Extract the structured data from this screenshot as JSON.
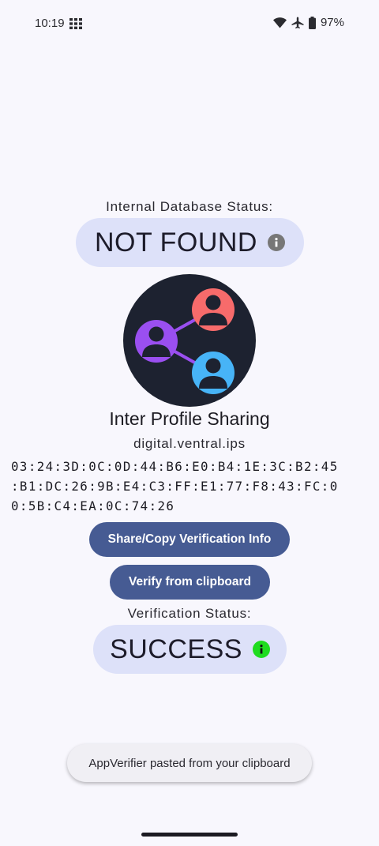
{
  "status_bar": {
    "time": "10:19",
    "battery": "97%",
    "icons": [
      "grid-icon",
      "wifi-icon",
      "airplane-mode-icon",
      "battery-icon"
    ]
  },
  "database": {
    "label": "Internal Database Status:",
    "status": "NOT FOUND",
    "info_icon_color": "#777777"
  },
  "app": {
    "name": "Inter Profile Sharing",
    "package": "digital.ventral.ips",
    "hash": "03:24:3D:0C:0D:44:B6:E0:B4:1E:3C:B2:45:B1:DC:26:9B:E4:C3:FF:E1:77:F8:43:FC:00:5B:C4:EA:0C:74:26",
    "hash_lines": [
      "03:24:3D:0C:0D:44:B6:E0:B4:1E:3C:B2:45",
      ":B1:DC:26:9B:E4:C3:FF:E1:77:F8:43:FC:0",
      "0:5B:C4:EA:0C:74:26"
    ]
  },
  "buttons": {
    "share": "Share/Copy Verification Info",
    "verify": "Verify from clipboard"
  },
  "verification": {
    "label": "Verification Status:",
    "status": "SUCCESS",
    "info_icon_color": "#1fdc1f"
  },
  "toast": {
    "message": "AppVerifier pasted from your clipboard"
  },
  "colors": {
    "background": "#f8f7fd",
    "pill": "#dde1f9",
    "button": "#465b93",
    "logo_bg": "#1d2230",
    "person_red": "#f76b6b",
    "person_purple": "#9a4ff0",
    "person_blue": "#47b4f7"
  }
}
